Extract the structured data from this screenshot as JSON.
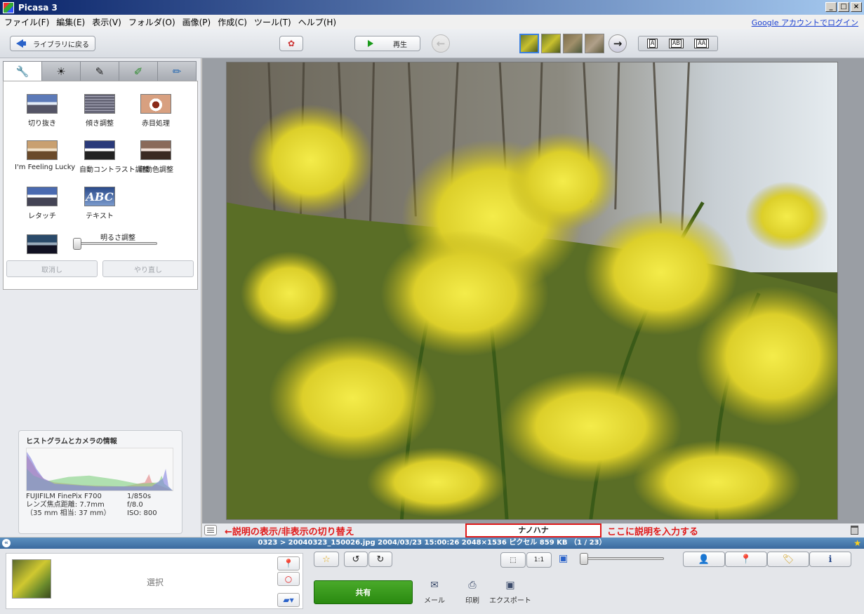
{
  "window": {
    "title": "Picasa 3",
    "min": "_",
    "max": "□",
    "close": "×"
  },
  "menu": {
    "items": [
      "ファイル(F)",
      "編集(E)",
      "表示(V)",
      "フォルダ(O)",
      "画像(P)",
      "作成(C)",
      "ツール(T)",
      "ヘルプ(H)"
    ],
    "login": "Google アカウントでログイン"
  },
  "toolbar": {
    "back_label": "ライブラリに戻る",
    "play_label": "再生",
    "prev_icon": "left-arrow-icon",
    "next_icon": "right-arrow-icon",
    "layout_options": [
      "A",
      "AB",
      "AA"
    ]
  },
  "edit_tabs": [
    {
      "icon": "wrench-icon",
      "glyph": "🔧"
    },
    {
      "icon": "sun-icon",
      "glyph": "☀"
    },
    {
      "icon": "brush-icon",
      "glyph": "✎"
    },
    {
      "icon": "brush-green-icon",
      "glyph": "✐"
    },
    {
      "icon": "brush-blue-icon",
      "glyph": "✏"
    }
  ],
  "tools": {
    "crop": "切り抜き",
    "straighten": "傾き調整",
    "redeye": "赤目処理",
    "lucky": "I'm Feeling Lucky",
    "auto_contrast": "自動コントラスト調整",
    "auto_color": "自動色調整",
    "retouch": "レタッチ",
    "text": "テキスト",
    "text_sample": "ABC",
    "brightness_label": "明るさ調整",
    "undo": "取消し",
    "redo": "やり直し"
  },
  "histogram": {
    "title": "ヒストグラムとカメラの情報",
    "camera": "FUJIFILM FinePix F700",
    "focal": "レンズ焦点距離: 7.7mm",
    "focal35": "（35 mm 相当:  37 mm）",
    "shutter": "1/850s",
    "aperture": "f/8.0",
    "iso": "ISO: 800"
  },
  "caption": {
    "toggle_annotation": "←説明の表示/非表示の切り替え",
    "value": "ナノハナ",
    "input_annotation": "ここに説明を入力する"
  },
  "status": {
    "text": "0323 > 20040323_150026.jpg 2004/03/23 15:00:26 2048×1536 ピクセル 859 KB   （1 / 23）"
  },
  "tray": {
    "label": "選択"
  },
  "bottom": {
    "share": "共有",
    "mail": "メール",
    "print": "印刷",
    "export": "エクスポート",
    "fit_label": "1:1"
  },
  "colors": {
    "accent": "#2a62c9",
    "share_green": "#2a8a10",
    "annotation_red": "#e01818",
    "status_blue": "#3a6a9e"
  }
}
